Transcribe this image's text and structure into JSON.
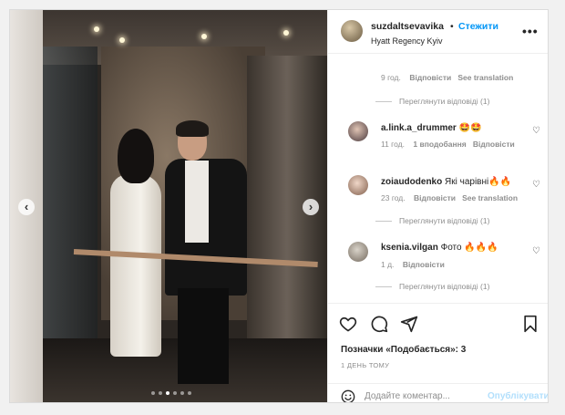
{
  "post": {
    "username": "suzdaltsevavika",
    "dot": "•",
    "follow_label": "Стежити",
    "location": "Hyatt Regency Kyiv",
    "more_icon": "more-horizontal-icon"
  },
  "carousel": {
    "prev_icon": "chevron-left-icon",
    "next_icon": "chevron-right-icon",
    "prev_glyph": "‹",
    "next_glyph": "›",
    "slides": 6,
    "active_index": 2
  },
  "comments": [
    {
      "username": "",
      "text": "",
      "time": "9 год.",
      "likes": "",
      "reply_label": "Відповісти",
      "translate_label": "See translation",
      "view_replies": "Переглянути відповіді (1)"
    },
    {
      "username": "a.link.a_drummer",
      "text": "🤩🤩",
      "time": "11 год.",
      "likes": "1 вподобання",
      "reply_label": "Відповісти",
      "translate_label": "",
      "view_replies": ""
    },
    {
      "username": "zoiaudodenko",
      "text": "Які чарівні🔥🔥",
      "time": "23 год.",
      "likes": "",
      "reply_label": "Відповісти",
      "translate_label": "See translation",
      "view_replies": "Переглянути відповіді (1)"
    },
    {
      "username": "ksenia.vilgan",
      "text": "Фото 🔥🔥🔥",
      "time": "1 д.",
      "likes": "",
      "reply_label": "Відповісти",
      "translate_label": "",
      "view_replies": "Переглянути відповіді (1)"
    }
  ],
  "view_replies_first": "Переглянути відповіді (1)",
  "actions": {
    "like_icon": "heart-icon",
    "comment_icon": "comment-icon",
    "share_icon": "paper-plane-icon",
    "save_icon": "bookmark-icon",
    "likes_text": "Позначки «Подобається»: 3",
    "date_text": "1 ДЕНЬ ТОМУ"
  },
  "add_comment": {
    "emoji_icon": "smiley-icon",
    "placeholder": "Додайте коментар...",
    "publish_label": "Опублікувати"
  },
  "colors": {
    "accent": "#0095f6",
    "publish_disabled": "#b2dffc",
    "muted": "#8e8e8e"
  }
}
